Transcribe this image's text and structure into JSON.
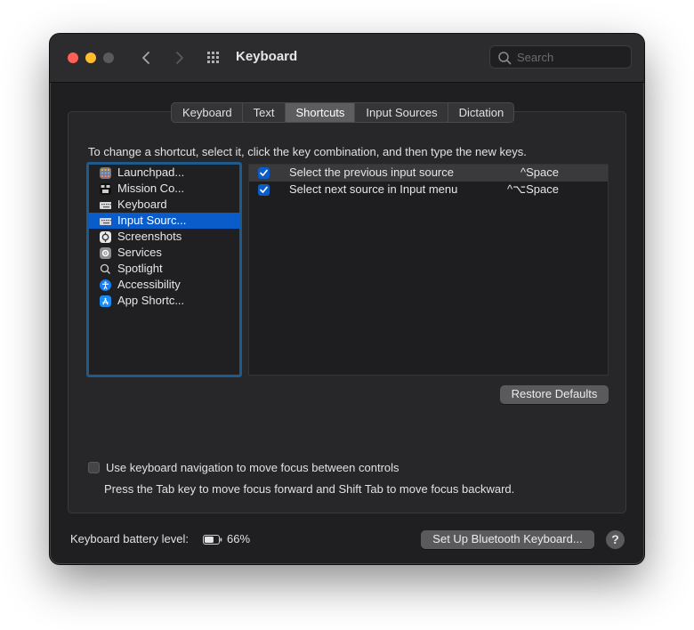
{
  "window": {
    "title": "Keyboard",
    "search_placeholder": "Search"
  },
  "tabs": [
    {
      "label": "Keyboard",
      "active": false
    },
    {
      "label": "Text",
      "active": false
    },
    {
      "label": "Shortcuts",
      "active": true
    },
    {
      "label": "Input Sources",
      "active": false
    },
    {
      "label": "Dictation",
      "active": false
    }
  ],
  "instruction": "To change a shortcut, select it, click the key combination, and then type the new keys.",
  "categories": [
    {
      "label": "Launchpad...",
      "icon": "launchpad-icon",
      "selected": false
    },
    {
      "label": "Mission Co...",
      "icon": "mission-control-icon",
      "selected": false
    },
    {
      "label": "Keyboard",
      "icon": "keyboard-icon",
      "selected": false
    },
    {
      "label": "Input Sourc...",
      "icon": "keyboard-icon",
      "selected": true
    },
    {
      "label": "Screenshots",
      "icon": "screenshot-icon",
      "selected": false
    },
    {
      "label": "Services",
      "icon": "gear-icon",
      "selected": false
    },
    {
      "label": "Spotlight",
      "icon": "spotlight-icon",
      "selected": false
    },
    {
      "label": "Accessibility",
      "icon": "accessibility-icon",
      "selected": false
    },
    {
      "label": "App Shortc...",
      "icon": "app-store-icon",
      "selected": false
    }
  ],
  "shortcuts": [
    {
      "name": "Select the previous input source",
      "keys": "^Space",
      "checked": true
    },
    {
      "name": "Select next source in Input menu",
      "keys": "^⌥Space",
      "checked": true
    }
  ],
  "restore_defaults_label": "Restore Defaults",
  "keyboard_navigation": {
    "label": "Use keyboard navigation to move focus between controls",
    "checked": false,
    "help": "Press the Tab key to move focus forward and Shift Tab to move focus backward."
  },
  "battery": {
    "label": "Keyboard battery level:",
    "value": "66%",
    "level": 0.66
  },
  "bluetooth_button_label": "Set Up Bluetooth Keyboard...",
  "help_label": "?",
  "colors": {
    "accent": "#0a5ccb",
    "close": "#ff5f57",
    "minimize": "#febc2e"
  }
}
